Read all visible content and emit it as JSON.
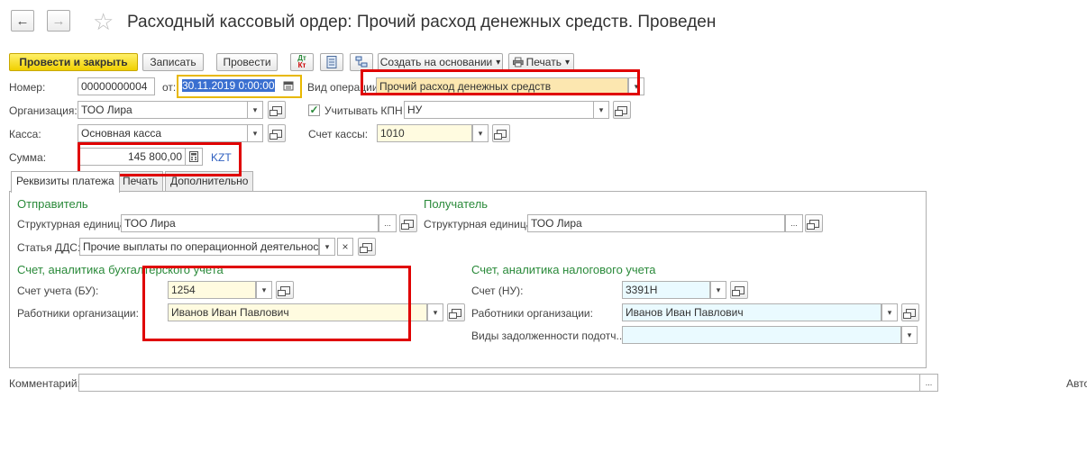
{
  "window": {
    "title": "Расходный кассовый ордер: Прочий расход денежных средств. Проведен",
    "back_glyph": "←",
    "forward_glyph": "→",
    "favorite_glyph": "☆"
  },
  "toolbar": {
    "post_and_close": "Провести и закрыть",
    "save": "Записать",
    "post": "Провести",
    "dt_kt_label_top": "Дт",
    "dt_kt_label_bottom": "Кт",
    "create_based_on": "Создать на основании",
    "print": "Печать"
  },
  "header": {
    "number_label": "Номер:",
    "number_value": "00000000004",
    "date_label": "от:",
    "date_value": "30.11.2019  0:00:00",
    "operation_label": "Вид операции:",
    "operation_value": "Прочий расход денежных средств",
    "organization_label": "Организация:",
    "organization_value": "ТОО Лира",
    "kpn_label": "Учитывать КПН",
    "kpn_checked": true,
    "kpn_value": "НУ",
    "cash_label": "Касса:",
    "cash_value": "Основная касса",
    "cash_account_label": "Счет кассы:",
    "cash_account_value": "1010",
    "amount_label": "Сумма:",
    "amount_value": "145 800,00",
    "currency": "KZT"
  },
  "tabs": [
    {
      "label": "Реквизиты платежа",
      "active": true
    },
    {
      "label": "Печать",
      "active": false
    },
    {
      "label": "Дополнительно",
      "active": false
    }
  ],
  "sender": {
    "heading": "Отправитель",
    "unit_label": "Структурная единица:",
    "unit_value": "ТОО Лира",
    "dds_label": "Статья ДДС:",
    "dds_value": "Прочие выплаты по операционной деятельности"
  },
  "receiver": {
    "heading": "Получатель",
    "unit_label": "Структурная единица:",
    "unit_value": "ТОО Лира"
  },
  "accounting": {
    "heading": "Счет, аналитика бухгалтерского учета",
    "account_label": "Счет учета (БУ):",
    "account_value": "1254",
    "employees_label": "Работники организации:",
    "employees_value": "Иванов Иван Павлович"
  },
  "tax": {
    "heading": "Счет, аналитика налогового учета",
    "account_label": "Счет (НУ):",
    "account_value": "3391Н",
    "employees_label": "Работники организации:",
    "employees_value": "Иванов Иван Павлович",
    "debt_label": "Виды задолженности подотч...",
    "debt_value": ""
  },
  "footer": {
    "comment_label": "Комментарий:",
    "comment_value": "",
    "author_label": "Авто"
  },
  "glyphs": {
    "dropdown": "▾",
    "ellipsis": "...",
    "clear": "×"
  },
  "colors": {
    "highlight_red": "#e00000",
    "section_green": "#2a8a3a",
    "primary_yellow": "#f0d000",
    "date_border": "#e8b800"
  }
}
